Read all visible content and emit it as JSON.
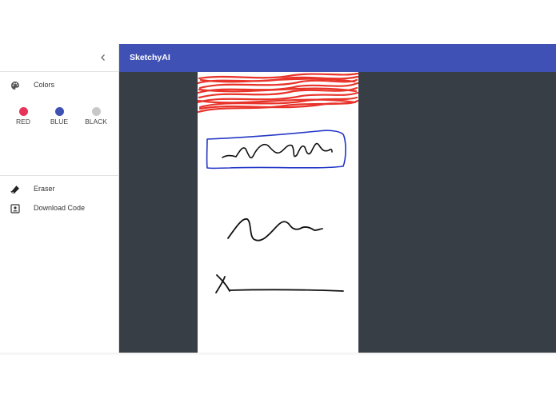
{
  "app": {
    "title": "SketchyAI"
  },
  "sidebar": {
    "collapse_icon": "chevron-left-icon",
    "colors_section": {
      "label": "Colors",
      "icon": "palette-icon"
    },
    "colors": [
      {
        "name": "RED",
        "hex": "#e8345a"
      },
      {
        "name": "BLUE",
        "hex": "#3f51b5"
      },
      {
        "name": "BLACK",
        "hex": "#c8c8c8"
      }
    ],
    "tools": [
      {
        "label": "Eraser",
        "icon": "eraser-icon"
      },
      {
        "label": "Download Code",
        "icon": "download-code-icon"
      }
    ]
  },
  "theme": {
    "accent": "#3f51b5",
    "workspace": "#373e45",
    "canvas": "#ffffff"
  },
  "canvas": {
    "strokes": [
      {
        "kind": "scribble",
        "color": "#e8332a"
      },
      {
        "kind": "rectangle",
        "color": "#2337c6"
      },
      {
        "kind": "squiggle",
        "color": "#111111"
      },
      {
        "kind": "squiggle",
        "color": "#111111"
      },
      {
        "kind": "x-mark",
        "color": "#111111"
      },
      {
        "kind": "line",
        "color": "#111111"
      }
    ]
  }
}
